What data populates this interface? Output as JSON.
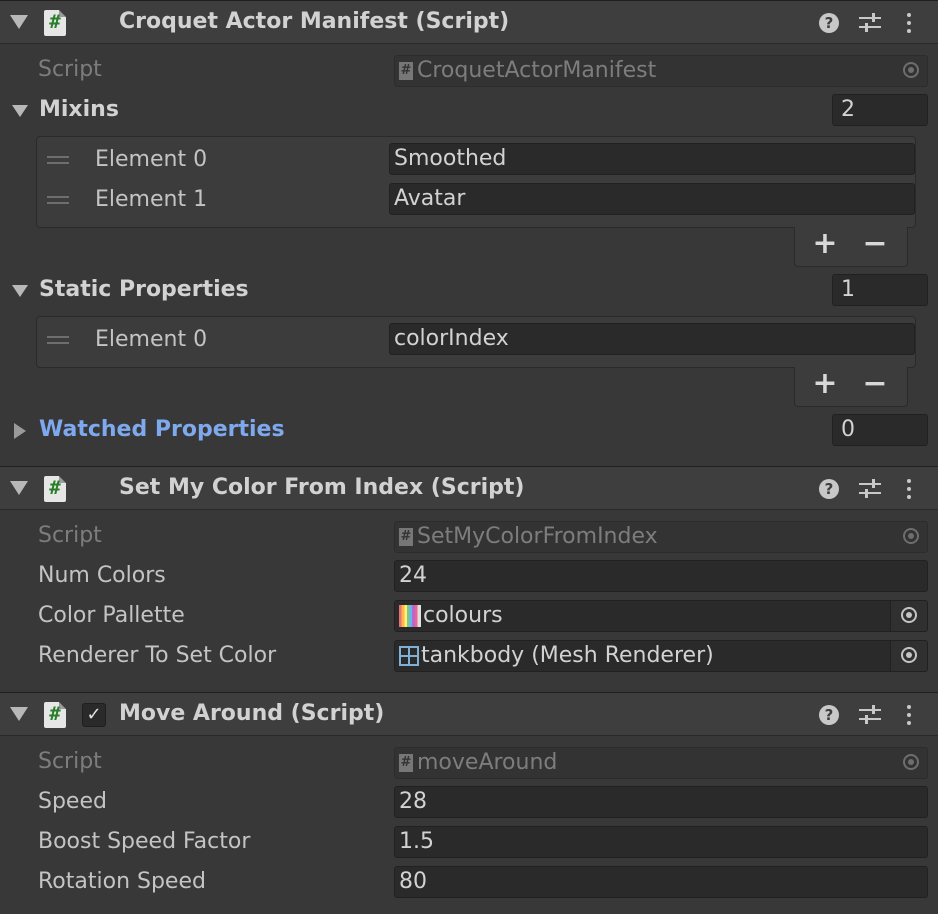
{
  "components": [
    {
      "title": "Croquet Actor Manifest (Script)",
      "script_label": "Script",
      "script_value": "CroquetActorManifest",
      "mixins": {
        "label": "Mixins",
        "count": "2",
        "elements": [
          {
            "label": "Element 0",
            "value": "Smoothed"
          },
          {
            "label": "Element 1",
            "value": "Avatar"
          }
        ]
      },
      "static_properties": {
        "label": "Static Properties",
        "count": "1",
        "elements": [
          {
            "label": "Element 0",
            "value": "colorIndex"
          }
        ]
      },
      "watched_properties": {
        "label": "Watched Properties",
        "count": "0"
      }
    },
    {
      "title": "Set My Color From Index (Script)",
      "script_label": "Script",
      "script_value": "SetMyColorFromIndex",
      "fields": [
        {
          "label": "Num Colors",
          "value": "24"
        },
        {
          "label": "Color Pallette",
          "value": "colours",
          "icon": "texture-icon"
        },
        {
          "label": "Renderer To Set Color",
          "value": "tankbody (Mesh Renderer)",
          "icon": "mesh-renderer-icon"
        }
      ]
    },
    {
      "title": "Move Around (Script)",
      "enabled_check": "✓",
      "script_label": "Script",
      "script_value": "moveAround",
      "fields": [
        {
          "label": "Speed",
          "value": "28"
        },
        {
          "label": "Boost Speed Factor",
          "value": "1.5"
        },
        {
          "label": "Rotation Speed",
          "value": "80"
        }
      ]
    }
  ],
  "list_footer": {
    "add": "+",
    "remove": "−"
  },
  "header_icons": {
    "help": "?",
    "hash": "#"
  },
  "colors": {
    "background": "#383838",
    "header": "#3e3e3e",
    "field": "#2a2a2a",
    "watched_label": "#7fa9ee",
    "script_hash": "#2a7d2a"
  }
}
